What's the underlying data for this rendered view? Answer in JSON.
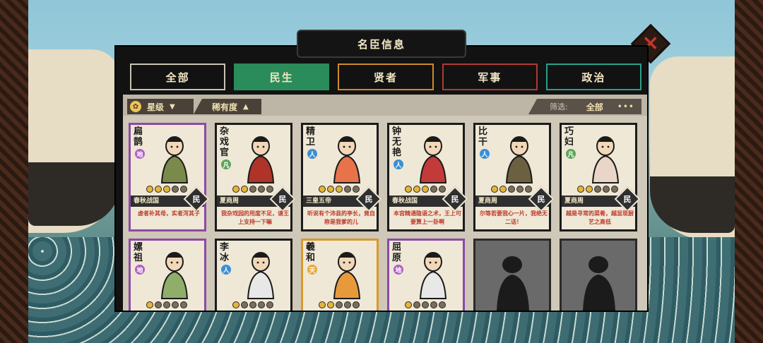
{
  "title": "名臣信息",
  "tabs": [
    {
      "label": "全部",
      "border": "#c8c2b4",
      "bg": "#121212",
      "active": false
    },
    {
      "label": "民生",
      "border": "#2a8c5a",
      "bg": "#2a8c5a",
      "active": true
    },
    {
      "label": "贤者",
      "border": "#d08a2a",
      "bg": "#121212",
      "active": false
    },
    {
      "label": "军事",
      "border": "#b03a32",
      "bg": "#121212",
      "active": false
    },
    {
      "label": "政治",
      "border": "#2aa08a",
      "bg": "#121212",
      "active": false
    }
  ],
  "filters": {
    "star_label": "星级",
    "star_arrow": "▼",
    "rarity_label": "稀有度",
    "rarity_arrow": "▲",
    "filter_label": "筛选:",
    "filter_value": "全部",
    "more": "•••"
  },
  "close_icon": "×",
  "cards": [
    {
      "name": "扁鹊",
      "tier": "地",
      "tier_type": "earth",
      "rarity": "rare-purple",
      "stars": 3,
      "era": "春秋战国",
      "tag": "民",
      "quote": "虚者补其母，实者泻其子"
    },
    {
      "name": "杂戏官",
      "tier": "凡",
      "tier_type": "common",
      "rarity": "",
      "stars": 2,
      "era": "夏商周",
      "tag": "民",
      "quote": "我杂戏园的用度不足，请王上支持一下嘛"
    },
    {
      "name": "精卫",
      "tier": "人",
      "tier_type": "person",
      "rarity": "",
      "stars": 3,
      "era": "三皇五帝",
      "tag": "民",
      "quote": "听说有个沛县的亭长，竟自称是我爹的儿"
    },
    {
      "name": "钟无艳",
      "tier": "人",
      "tier_type": "person",
      "rarity": "",
      "stars": 3,
      "era": "春秋战国",
      "tag": "民",
      "quote": "本宫精通隐语之术，王上可要算上一卦啊"
    },
    {
      "name": "比干",
      "tier": "人",
      "tier_type": "person",
      "rarity": "",
      "stars": 2,
      "era": "夏商周",
      "tag": "民",
      "quote": "尔等若要我心一片，我绝无二话！"
    },
    {
      "name": "巧妇",
      "tier": "凡",
      "tier_type": "common",
      "rarity": "",
      "stars": 2,
      "era": "夏商周",
      "tag": "民",
      "quote": "越是寻常的菜肴，越显现厨艺之高低"
    },
    {
      "name": "嫘祖",
      "tier": "地",
      "tier_type": "earth",
      "rarity": "rare-purple",
      "stars": 1,
      "era": "",
      "tag": "",
      "quote": ""
    },
    {
      "name": "李冰",
      "tier": "人",
      "tier_type": "person",
      "rarity": "",
      "stars": 1,
      "era": "",
      "tag": "",
      "quote": ""
    },
    {
      "name": "羲和",
      "tier": "天",
      "tier_type": "sky",
      "rarity": "rare-orange",
      "stars": 2,
      "era": "",
      "tag": "",
      "quote": ""
    },
    {
      "name": "屈原",
      "tier": "地",
      "tier_type": "earth",
      "rarity": "rare-purple",
      "stars": 1,
      "era": "",
      "tag": "",
      "quote": ""
    },
    {
      "locked": true,
      "label": "???"
    },
    {
      "locked": true,
      "label": "???"
    }
  ]
}
